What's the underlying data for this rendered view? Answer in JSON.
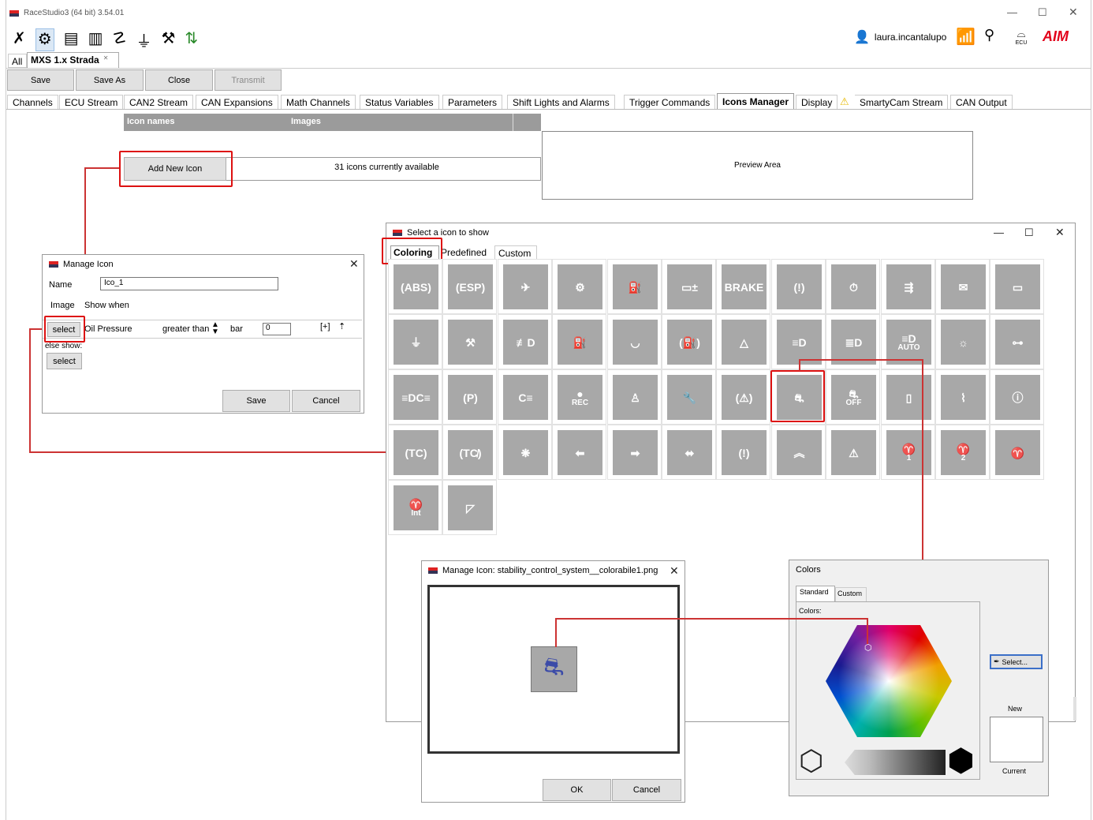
{
  "app": {
    "title": "RaceStudio3 (64 bit) 3.54.01",
    "user": "laura.incantalupo",
    "ecu_label": "ECU"
  },
  "doc_tabs": {
    "all": "All",
    "device": "MXS 1.x Strada",
    "close_glyph": "✕"
  },
  "toolbar": {
    "save": "Save",
    "save_as": "Save As",
    "close": "Close",
    "transmit": "Transmit"
  },
  "config_tabs": [
    "Channels",
    "ECU Stream",
    "CAN2 Stream",
    "CAN Expansions",
    "Math Channels",
    "Status Variables",
    "Parameters",
    "Shift Lights and Alarms",
    "Trigger Commands",
    "Icons Manager",
    "Display",
    "SmartyCam Stream",
    "CAN Output"
  ],
  "icons_table": {
    "col_names": "Icon names",
    "col_images": "Images",
    "add_button": "Add New Icon",
    "available": "31 icons currently available",
    "preview": "Preview Area"
  },
  "select_dialog": {
    "title": "Select a icon to show",
    "tabs": [
      "Coloring",
      "Predefined",
      "Custom"
    ],
    "icons": [
      {
        "name": "abs-icon",
        "label": "(ABS)"
      },
      {
        "name": "esp-icon",
        "label": "(ESP)"
      },
      {
        "name": "airbag-icon",
        "label": "✈"
      },
      {
        "name": "gear-warning-icon",
        "label": "⚙"
      },
      {
        "name": "fuel-can-icon",
        "label": "⛽"
      },
      {
        "name": "battery-icon",
        "label": "▭±"
      },
      {
        "name": "brake-icon",
        "label": "BRAKE"
      },
      {
        "name": "brake-warning-icon",
        "label": "(!)"
      },
      {
        "name": "stopwatch-icon",
        "label": "⏱"
      },
      {
        "name": "sensor-icon",
        "label": "⇶"
      },
      {
        "name": "envelope-icon",
        "label": "✉"
      },
      {
        "name": "oil-level-icon",
        "label": "▭"
      },
      {
        "name": "coolant-temp-icon",
        "label": "⏚"
      },
      {
        "name": "engine-icon",
        "label": "⚒"
      },
      {
        "name": "fog-light-icon",
        "label": "≢D"
      },
      {
        "name": "fuel-pump-icon",
        "label": "⛽"
      },
      {
        "name": "windshield-icon",
        "label": "◡"
      },
      {
        "name": "fuel-circle-icon",
        "label": "(⛽)"
      },
      {
        "name": "hazard-icon",
        "label": "△"
      },
      {
        "name": "low-beam-icon",
        "label": "≡D"
      },
      {
        "name": "high-beam-icon",
        "label": "≣D"
      },
      {
        "name": "auto-beam-icon",
        "label": "≡D",
        "sub": "AUTO"
      },
      {
        "name": "light-sun-icon",
        "label": "☼"
      },
      {
        "name": "oil-can-icon",
        "label": "⊶"
      },
      {
        "name": "side-lights-icon",
        "label": "≡DC≡"
      },
      {
        "name": "parking-brake-icon",
        "label": "(P)"
      },
      {
        "name": "rear-fog-icon",
        "label": "C≡"
      },
      {
        "name": "rec-icon",
        "label": "●",
        "sub": "REC"
      },
      {
        "name": "seatbelt-icon",
        "label": "♙"
      },
      {
        "name": "wrench-icon",
        "label": "🔧"
      },
      {
        "name": "warning-circle-icon",
        "label": "(⚠)"
      },
      {
        "name": "stability-control-icon",
        "label": "⛐"
      },
      {
        "name": "stability-off-icon",
        "label": "⛐",
        "sub": "OFF"
      },
      {
        "name": "door-icon",
        "label": "▯"
      },
      {
        "name": "suspension-icon",
        "label": "⌇"
      },
      {
        "name": "info-icon",
        "label": "ⓘ"
      },
      {
        "name": "traction-control-icon",
        "label": "(TC)"
      },
      {
        "name": "traction-off-icon",
        "label": "(TC̸)"
      },
      {
        "name": "fan-icon",
        "label": "❋"
      },
      {
        "name": "arrow-left-icon",
        "label": "⬅"
      },
      {
        "name": "arrow-right-icon",
        "label": "➡"
      },
      {
        "name": "arrow-both-icon",
        "label": "⬌"
      },
      {
        "name": "tire-pressure-icon",
        "label": "(!)"
      },
      {
        "name": "chevron-up-icon",
        "label": "︽"
      },
      {
        "name": "triangle-warning-icon",
        "label": "⚠"
      },
      {
        "name": "wiper-1-icon",
        "label": "♈",
        "sub": "1"
      },
      {
        "name": "wiper-2-icon",
        "label": "♈",
        "sub": "2"
      },
      {
        "name": "wiper-icon",
        "label": "♈"
      },
      {
        "name": "wiper-int-icon",
        "label": "♈",
        "sub": "Int"
      },
      {
        "name": "wiper-plain-icon",
        "label": "◸"
      }
    ]
  },
  "manage_icon": {
    "title": "Manage Icon",
    "name_label": "Name",
    "name_value": "Ico_1",
    "image_label": "Image",
    "show_when_label": "Show when",
    "select": "select",
    "channel": "Oil Pressure",
    "condition": "greater than",
    "unit": "bar",
    "value": "0",
    "else_show": "else show:",
    "save": "Save",
    "cancel": "Cancel"
  },
  "manage_icon_file": {
    "title": "Manage Icon: stability_control_system__colorabile1.png",
    "ok": "OK",
    "cancel": "Cancel",
    "icon_color": "#3b4ba8"
  },
  "colors_dialog": {
    "title": "Colors",
    "tabs": [
      "Standard",
      "Custom"
    ],
    "colors_label": "Colors:",
    "select": "Select...",
    "new_label": "New",
    "current_label": "Current"
  },
  "accent": {
    "red": "#d11111",
    "aim_red": "#e2001a"
  }
}
